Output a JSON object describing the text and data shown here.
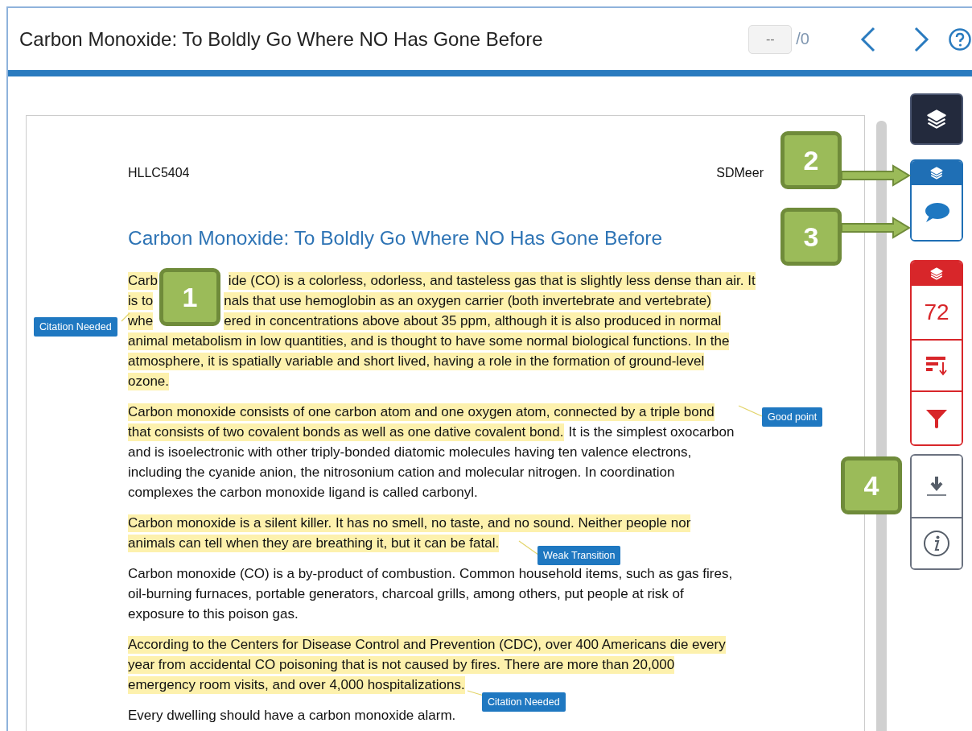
{
  "header": {
    "title": "Carbon Monoxide: To Boldly Go Where NO Has Gone Before",
    "counter": {
      "value": "--",
      "total": "/0"
    }
  },
  "document": {
    "course": "HLLC5404",
    "author": "SDMeer",
    "title": "Carbon Monoxide: To Boldly Go Where NO Has Gone Before",
    "paragraphs": [
      {
        "lines": [
          {
            "segments": [
              {
                "text": "Carb",
                "highlighted": true
              },
              {
                "text": "ide (CO) is a colorless, odorless, and tasteless gas that is slightly less dense than air. It",
                "highlighted": true,
                "after_callout": true
              }
            ]
          },
          {
            "segments": [
              {
                "text": "is to",
                "highlighted": true
              },
              {
                "text": "nals that use hemoglobin as an oxygen carrier (both invertebrate and vertebrate)",
                "highlighted": true,
                "after_callout": true
              }
            ]
          },
          {
            "segments": [
              {
                "text": "whe",
                "highlighted": true
              },
              {
                "text": "ered in concentrations above about 35 ppm, although it is also produced in normal",
                "highlighted": true,
                "after_callout": true
              }
            ]
          },
          {
            "segments": [
              {
                "text": "animal metabolism in low quantities, and is thought to have some normal biological functions. In the",
                "highlighted": true
              }
            ]
          },
          {
            "segments": [
              {
                "text": "atmosphere, it is spatially variable and short lived, having a role in the formation of ground-level",
                "highlighted": true
              }
            ]
          },
          {
            "segments": [
              {
                "text": "ozone.",
                "highlighted": true
              }
            ]
          }
        ]
      },
      {
        "lines": [
          {
            "segments": [
              {
                "text": "Carbon monoxide consists of one carbon atom and one oxygen atom, connected by a triple bond",
                "highlighted": true
              }
            ]
          },
          {
            "segments": [
              {
                "text": "that consists of two covalent bonds as well as one dative covalent bond.",
                "highlighted": true
              },
              {
                "text": "It is the simplest oxocarbon",
                "highlighted": false
              }
            ]
          },
          {
            "segments": [
              {
                "text": "and is isoelectronic with other triply-bonded diatomic molecules having ten valence electrons,",
                "highlighted": false
              }
            ]
          },
          {
            "segments": [
              {
                "text": "including the cyanide anion, the nitrosonium cation and molecular nitrogen. In coordination",
                "highlighted": false
              }
            ]
          },
          {
            "segments": [
              {
                "text": "complexes the carbon monoxide ligand is called carbonyl.",
                "highlighted": false
              }
            ]
          }
        ]
      },
      {
        "lines": [
          {
            "segments": [
              {
                "text": "Carbon monoxide is a silent killer. It has no smell, no taste, and no sound. Neither people nor",
                "highlighted": true
              }
            ]
          },
          {
            "segments": [
              {
                "text": "animals can tell when they are breathing it, but it can be fatal.",
                "highlighted": true
              }
            ]
          }
        ]
      },
      {
        "lines": [
          {
            "segments": [
              {
                "text": "Carbon monoxide (CO) is a by-product of combustion. Common household items, such as gas fires,",
                "highlighted": false
              }
            ]
          },
          {
            "segments": [
              {
                "text": "oil-burning furnaces, portable generators, charcoal grills, among others, put people at risk of",
                "highlighted": false
              }
            ]
          },
          {
            "segments": [
              {
                "text": "exposure to this poison gas.",
                "highlighted": false
              }
            ]
          }
        ]
      },
      {
        "lines": [
          {
            "segments": [
              {
                "text": "According to the Centers for Disease Control and Prevention (CDC), over 400 Americans die every",
                "highlighted": true
              }
            ]
          },
          {
            "segments": [
              {
                "text": "year from accidental CO poisoning that is not caused by fires. There are more than 20,000",
                "highlighted": true
              }
            ]
          },
          {
            "segments": [
              {
                "text": "emergency room visits, and over 4,000 hospitalizations.",
                "highlighted": true
              }
            ]
          }
        ]
      },
      {
        "lines": [
          {
            "segments": [
              {
                "text": "Every dwelling should have a carbon monoxide alarm.",
                "highlighted": false
              }
            ]
          }
        ]
      }
    ]
  },
  "comments": [
    {
      "label": "Citation Needed"
    },
    {
      "label": "Good point"
    },
    {
      "label": "Weak Transition"
    },
    {
      "label": "Citation Needed"
    }
  ],
  "toolbar": {
    "score": "72"
  },
  "callouts": [
    {
      "number": "1"
    },
    {
      "number": "2"
    },
    {
      "number": "3"
    },
    {
      "number": "4"
    }
  ]
}
